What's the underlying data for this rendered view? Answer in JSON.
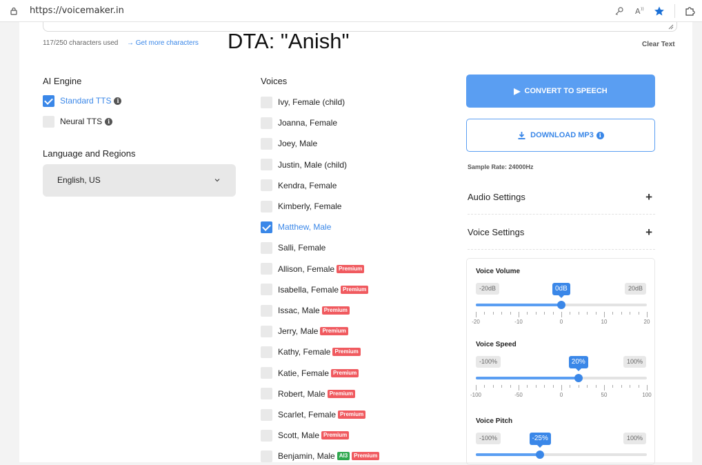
{
  "browser": {
    "url": "https://voicemaker.in",
    "icons": [
      "lock-icon",
      "key-icon",
      "read-aloud-icon",
      "favorite-star-icon",
      "extensions-icon"
    ]
  },
  "editor": {
    "char_count": "117/250 characters used",
    "more_chars_link": "→ Get more characters",
    "clear_text": "Clear Text",
    "overlay": "DTA: \"Anish\""
  },
  "ai_engine": {
    "label": "AI Engine",
    "options": [
      {
        "label": "Standard TTS",
        "checked": true
      },
      {
        "label": "Neural TTS",
        "checked": false
      }
    ]
  },
  "language": {
    "label": "Language and Regions",
    "selected": "English, US"
  },
  "voices": {
    "label": "Voices",
    "items": [
      {
        "label": "Ivy, Female (child)",
        "checked": false,
        "badges": []
      },
      {
        "label": "Joanna, Female",
        "checked": false,
        "badges": []
      },
      {
        "label": "Joey, Male",
        "checked": false,
        "badges": []
      },
      {
        "label": "Justin, Male (child)",
        "checked": false,
        "badges": []
      },
      {
        "label": "Kendra, Female",
        "checked": false,
        "badges": []
      },
      {
        "label": "Kimberly, Female",
        "checked": false,
        "badges": []
      },
      {
        "label": "Matthew, Male",
        "checked": true,
        "badges": []
      },
      {
        "label": "Salli, Female",
        "checked": false,
        "badges": []
      },
      {
        "label": "Allison, Female",
        "checked": false,
        "badges": [
          "Premium"
        ]
      },
      {
        "label": "Isabella, Female",
        "checked": false,
        "badges": [
          "Premium"
        ]
      },
      {
        "label": "Issac, Male",
        "checked": false,
        "badges": [
          "Premium"
        ]
      },
      {
        "label": "Jerry, Male",
        "checked": false,
        "badges": [
          "Premium"
        ]
      },
      {
        "label": "Kathy, Female",
        "checked": false,
        "badges": [
          "Premium"
        ]
      },
      {
        "label": "Katie, Female",
        "checked": false,
        "badges": [
          "Premium"
        ]
      },
      {
        "label": "Robert, Male",
        "checked": false,
        "badges": [
          "Premium"
        ]
      },
      {
        "label": "Scarlet, Female",
        "checked": false,
        "badges": [
          "Premium"
        ]
      },
      {
        "label": "Scott, Male",
        "checked": false,
        "badges": [
          "Premium"
        ]
      },
      {
        "label": "Benjamin, Male",
        "checked": false,
        "badges": [
          "AI3",
          "Premium"
        ]
      }
    ]
  },
  "actions": {
    "convert": "CONVERT TO SPEECH",
    "download": "DOWNLOAD MP3",
    "sample_rate": "Sample Rate: 24000Hz"
  },
  "settings": {
    "audio": "Audio Settings",
    "voice": "Voice Settings",
    "expand_symbol": "+"
  },
  "sliders": [
    {
      "title": "Voice Volume",
      "min_label": "-20dB",
      "max_label": "20dB",
      "value_label": "0dB",
      "min": -20,
      "max": 20,
      "value": 0,
      "ticks": [
        "-20",
        "-10",
        "0",
        "10",
        "20"
      ]
    },
    {
      "title": "Voice Speed",
      "min_label": "-100%",
      "max_label": "100%",
      "value_label": "20%",
      "min": -100,
      "max": 100,
      "value": 20,
      "ticks": [
        "-100",
        "-50",
        "0",
        "50",
        "100"
      ]
    },
    {
      "title": "Voice Pitch",
      "min_label": "-100%",
      "max_label": "100%",
      "value_label": "-25%",
      "min": -100,
      "max": 100,
      "value": -25,
      "ticks": []
    }
  ],
  "colors": {
    "accent": "#3a87e8",
    "premium_badge": "#f05a5f",
    "ai_badge": "#2fa84f"
  }
}
